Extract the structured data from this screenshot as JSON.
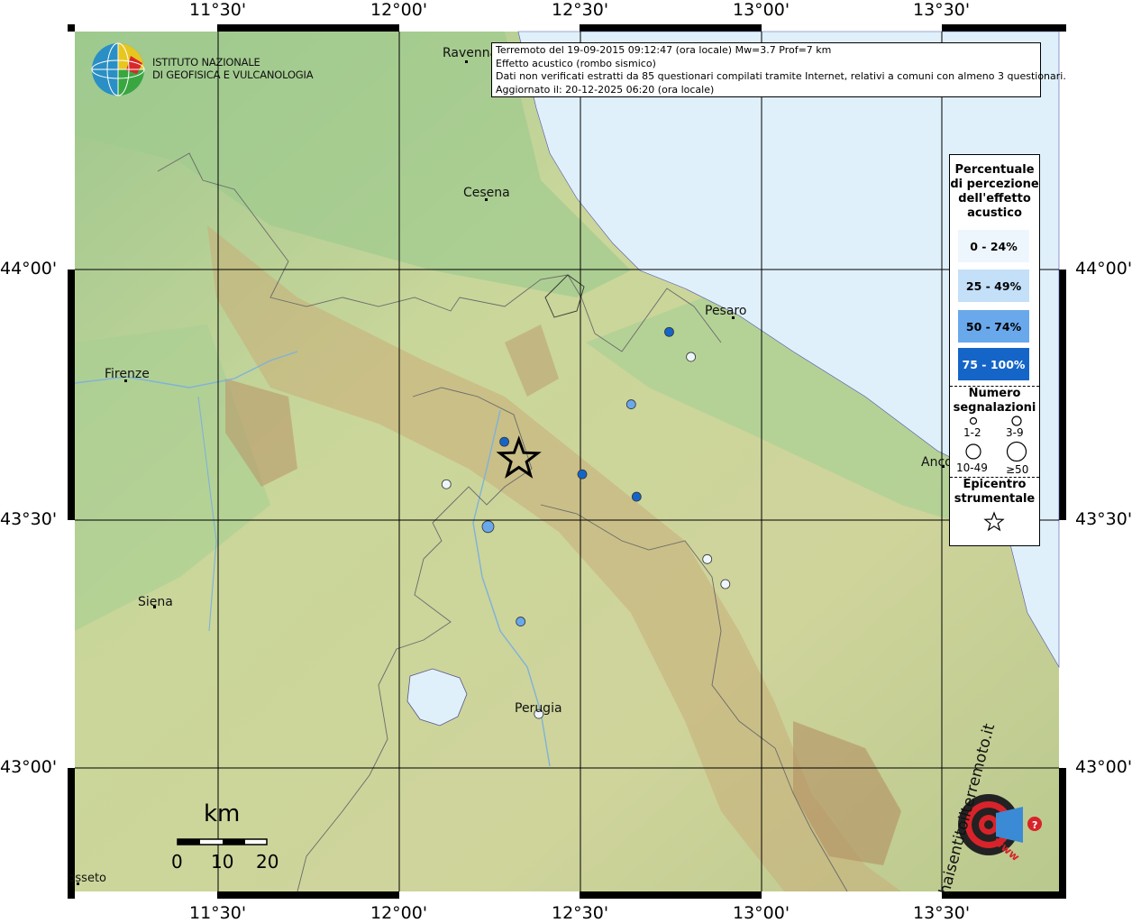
{
  "info_box": {
    "line1": "Terremoto del 19-09-2015 09:12:47 (ora locale) Mw=3.7 Prof=7 km",
    "line2": "Effetto acustico (rombo sismico)",
    "line3": "Dati non verificati estratti da 85 questionari compilati tramite Internet, relativi a comuni con almeno 3 questionari.",
    "line4": "Aggiornato il: 20-12-2025 06:20 (ora locale)"
  },
  "institute": {
    "line1": "ISTITUTO NAZIONALE",
    "line2": "DI GEOFISICA E VULCANOLOGIA"
  },
  "axes": {
    "lon_labels": [
      "11°30'",
      "12°00'",
      "12°30'",
      "13°00'",
      "13°30'"
    ],
    "lat_labels": [
      "44°00'",
      "43°30'",
      "43°00'"
    ]
  },
  "cities": {
    "ravenna": "Ravenna",
    "cesena": "Cesena",
    "pesaro": "Pesaro",
    "firenze": "Firenze",
    "ancona": "Ancona",
    "siena": "Siena",
    "perugia": "Perugia",
    "grosseto": "Grosseto"
  },
  "legend": {
    "title": [
      "Percentuale",
      "di percezione",
      "dell'effetto",
      "acustico"
    ],
    "classes": [
      {
        "label": "0 - 24%",
        "color": "#eef6fd"
      },
      {
        "label": "25 - 49%",
        "color": "#c4dff8"
      },
      {
        "label": "50 - 74%",
        "color": "#6aa8ec"
      },
      {
        "label": "75 - 100%",
        "color": "#1565c8"
      }
    ],
    "count_title": [
      "Numero",
      "segnalazioni"
    ],
    "count_labels": [
      "1-2",
      "3-9",
      "10-49",
      "≥50"
    ],
    "epicenter_title": [
      "Epicentro",
      "strumentale"
    ]
  },
  "scale": {
    "unit": "km",
    "ticks": [
      "0",
      "10",
      "20"
    ]
  },
  "watermark": {
    "text": "haisentitoilterremoto.it",
    "url": "www"
  },
  "map_data": {
    "epicenter": {
      "lon": 12.33,
      "lat": 43.62
    },
    "observations": [
      {
        "lon": 12.745,
        "lat": 43.875,
        "class": 3,
        "count": "1-2"
      },
      {
        "lon": 12.805,
        "lat": 43.825,
        "class": 0,
        "count": "1-2"
      },
      {
        "lon": 12.64,
        "lat": 43.73,
        "class": 2,
        "count": "1-2"
      },
      {
        "lon": 12.29,
        "lat": 43.655,
        "class": 3,
        "count": "1-2"
      },
      {
        "lon": 12.505,
        "lat": 43.59,
        "class": 3,
        "count": "1-2"
      },
      {
        "lon": 12.655,
        "lat": 43.545,
        "class": 3,
        "count": "1-2"
      },
      {
        "lon": 12.13,
        "lat": 43.57,
        "class": 0,
        "count": "1-2"
      },
      {
        "lon": 12.245,
        "lat": 43.485,
        "class": 2,
        "count": "3-9"
      },
      {
        "lon": 12.85,
        "lat": 43.42,
        "class": 0,
        "count": "1-2"
      },
      {
        "lon": 12.9,
        "lat": 43.37,
        "class": 0,
        "count": "1-2"
      },
      {
        "lon": 12.335,
        "lat": 43.295,
        "class": 2,
        "count": "1-2"
      },
      {
        "lon": 12.385,
        "lat": 43.11,
        "class": 0,
        "count": "1-2"
      }
    ]
  }
}
